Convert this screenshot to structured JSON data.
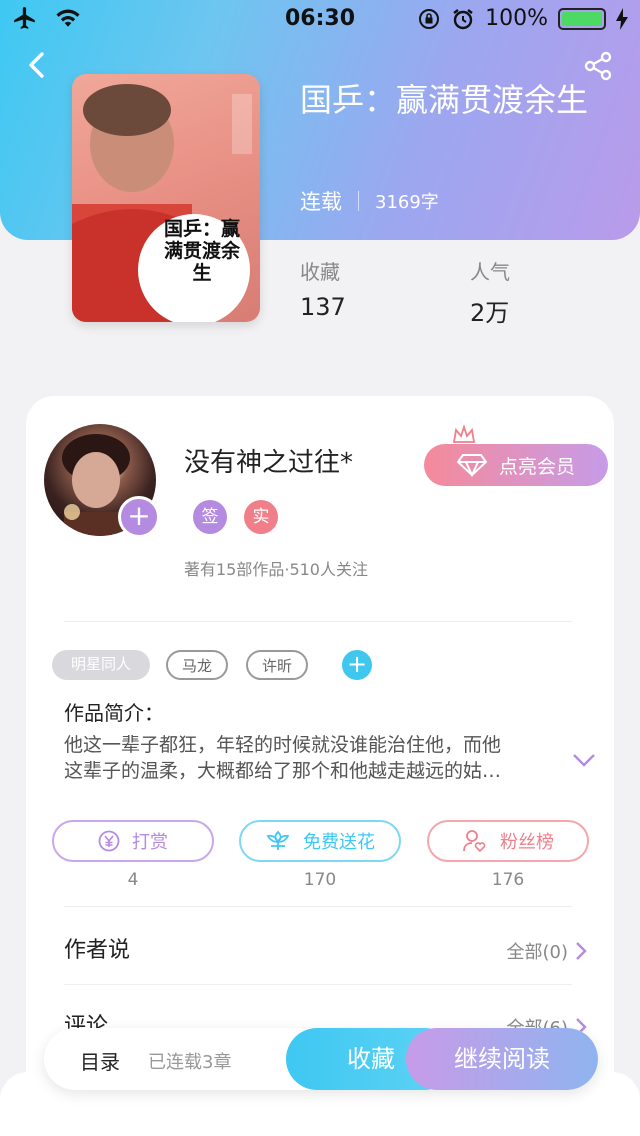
{
  "status_bar": {
    "time": "06:30",
    "battery": "100%"
  },
  "book": {
    "title": "国乒：赢满贯渡余生",
    "status": "连载",
    "word_count": "3169字",
    "collect_label": "收藏",
    "collect_value": "137",
    "popularity_label": "人气",
    "popularity_value": "2万",
    "cover_text": "国乒：赢满贯渡余生"
  },
  "author": {
    "name": "没有神之过往*",
    "vip_label": "点亮会员",
    "badges": [
      "签",
      "实"
    ],
    "info": "著有15部作品·510人关注"
  },
  "tags": [
    "明星同人",
    "马龙",
    "许昕"
  ],
  "intro": {
    "label": "作品简介：",
    "line1": "他这一辈子都狂，年轻的时候就没谁能治住他，而他",
    "line2": "这辈子的温柔，大概都给了那个和他越走越远的姑…"
  },
  "actions": [
    {
      "label": "打赏",
      "count": "4"
    },
    {
      "label": "免费送花",
      "count": "170"
    },
    {
      "label": "粉丝榜",
      "count": "176"
    }
  ],
  "sections": {
    "author_says": {
      "title": "作者说",
      "right": "全部(0)"
    },
    "comments": {
      "title": "评论",
      "right": "全部(6)"
    }
  },
  "bottom_bar": {
    "toc": "目录",
    "chapters": "已连载3章",
    "favorite": "收藏",
    "continue": "继续阅读"
  },
  "colors": {
    "cyan": "#3ec8f2",
    "purple": "#b58be2",
    "pink": "#f07f8a"
  }
}
